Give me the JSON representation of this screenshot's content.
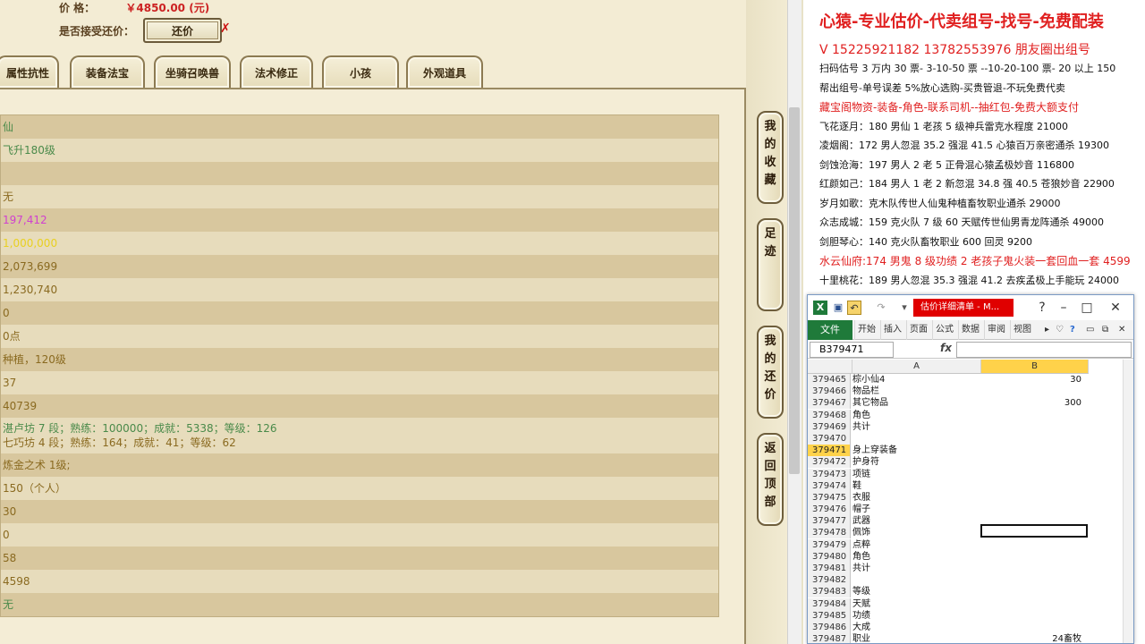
{
  "game": {
    "price_label": "价        格：",
    "price_value": "￥4850.00 (元)",
    "accept_label": "是否接受还价：",
    "counter_button": "还价",
    "close_mark": "✗",
    "tabs": [
      "属性抗性",
      "装备法宝",
      "坐骑召唤兽",
      "法术修正",
      "小孩",
      "外观道具"
    ],
    "rows": [
      {
        "text": "仙",
        "color": "#4a8a4a"
      },
      {
        "text": "飞升180级",
        "color": "#4a8a4a"
      },
      {
        "text": "",
        "color": "#333"
      },
      {
        "text": "无",
        "color": "#8a6a20"
      },
      {
        "text": "197,412",
        "color": "#d040d0"
      },
      {
        "text": "1,000,000",
        "color": "#e8d020"
      },
      {
        "text": "2,073,699",
        "color": "#8a6a20"
      },
      {
        "text": "1,230,740",
        "color": "#8a6a20"
      },
      {
        "text": "0",
        "color": "#8a6a20"
      },
      {
        "text": "0点",
        "color": "#8a6a20"
      },
      {
        "text": "种植，120级",
        "color": "#8a6a20"
      },
      {
        "text": "37",
        "color": "#8a6a20"
      },
      {
        "text": "40739",
        "color": "#8a6a20"
      },
      {
        "text": "湛卢坊 7 段；熟练：100000；成就：5338；等级：126",
        "text2": "七巧坊 4 段；熟练：164；成就：41；等级：62",
        "color": "#4a8a4a",
        "color2": "#8a6a20"
      },
      {
        "text": "炼金之术 1级;",
        "color": "#8a6a20"
      },
      {
        "text": "150（个人）",
        "color": "#8a6a20"
      },
      {
        "text": "30",
        "color": "#8a6a20"
      },
      {
        "text": "0",
        "color": "#8a6a20"
      },
      {
        "text": "58",
        "color": "#8a6a20"
      },
      {
        "text": "4598",
        "color": "#8a6a20"
      },
      {
        "text": "无",
        "color": "#4a8a4a"
      }
    ],
    "side_buttons": [
      "我的收藏",
      "足迹",
      "我的还价",
      "返回顶部"
    ]
  },
  "ad": {
    "title": "心猿-专业估价-代卖组号-找号-免费配装",
    "phones": "V 15225921182   13782553976 朋友圈出组号",
    "lines": [
      {
        "text": "扫码估号 3 万内 30 票- 3-10-50 票  --10-20-100 票- 20 以上 150",
        "red": false
      },
      {
        "text": "帮出组号-单号误差 5%放心选购-买贵管退-不玩免费代卖",
        "red": false
      },
      {
        "text": "藏宝阁物资-装备-角色-联系司机--抽红包-免费大额支付",
        "red": true
      },
      {
        "text": "飞花逐月：180 男仙 1 老孩 5 级神兵雷克水程度 21000",
        "red": false
      },
      {
        "text": "凌烟阁：172 男人忽混 35.2 强混 41.5 心猿百万亲密通杀 19300",
        "red": false
      },
      {
        "text": "剑蚀沧海：197 男人 2 老 5 正骨混心猿孟极妙音 116800",
        "red": false
      },
      {
        "text": "红颜如己：184 男人 1 老 2 新忽混 34.8 强 40.5 苍狼妙音 22900",
        "red": false
      },
      {
        "text": "岁月如歌：克木队传世人仙鬼种植畜牧职业通杀 29000",
        "red": false
      },
      {
        "text": "众志成城：159 克火队 7 级 60 天赋传世仙男青龙阵通杀 49000",
        "red": false
      },
      {
        "text": "剑胆琴心：140 克火队畜牧职业 600 回灵 9200",
        "red": false
      },
      {
        "text": "水云仙府:174 男鬼 8 级功绩 2 老孩子鬼火装一套回血一套 4599",
        "red": true
      },
      {
        "text": "十里桃花：189 男人忽混 35.3 强混 41.2 去疾孟极上手能玩 24000",
        "red": false
      }
    ]
  },
  "excel": {
    "doc_title": "估价详细清单 - M...",
    "ribbon_file": "文件",
    "ribbon_tabs": [
      "开始",
      "插入",
      "页面",
      "公式",
      "数据",
      "审阅",
      "视图"
    ],
    "name_box": "B379471",
    "fx": "fx",
    "col_a": "A",
    "col_b": "B",
    "selected_row": "379471",
    "rows": [
      {
        "n": "379465",
        "a": "棕小仙4",
        "b": "30"
      },
      {
        "n": "379466",
        "a": "物品栏",
        "b": ""
      },
      {
        "n": "379467",
        "a": "其它物品",
        "b": "300"
      },
      {
        "n": "379468",
        "a": "角色",
        "b": ""
      },
      {
        "n": "379469",
        "a": "共计",
        "b": ""
      },
      {
        "n": "379470",
        "a": "",
        "b": ""
      },
      {
        "n": "379471",
        "a": "身上穿装备",
        "b": ""
      },
      {
        "n": "379472",
        "a": "护身符",
        "b": ""
      },
      {
        "n": "379473",
        "a": "项链",
        "b": ""
      },
      {
        "n": "379474",
        "a": "鞋",
        "b": ""
      },
      {
        "n": "379475",
        "a": "衣服",
        "b": ""
      },
      {
        "n": "379476",
        "a": "帽子",
        "b": ""
      },
      {
        "n": "379477",
        "a": "武器",
        "b": ""
      },
      {
        "n": "379478",
        "a": "佩饰",
        "b": ""
      },
      {
        "n": "379479",
        "a": "点粹",
        "b": ""
      },
      {
        "n": "379480",
        "a": "角色",
        "b": ""
      },
      {
        "n": "379481",
        "a": "共计",
        "b": ""
      },
      {
        "n": "379482",
        "a": "",
        "b": ""
      },
      {
        "n": "379483",
        "a": "等级",
        "b": ""
      },
      {
        "n": "379484",
        "a": "天赋",
        "b": ""
      },
      {
        "n": "379485",
        "a": "功绩",
        "b": ""
      },
      {
        "n": "379486",
        "a": "大成",
        "b": ""
      },
      {
        "n": "379487",
        "a": "职业",
        "b": "24畜牧"
      }
    ]
  },
  "colors": {
    "panel_bg": "#f4edd6",
    "row_dark": "#d8c79e",
    "accent_red": "#e02020",
    "excel_green": "#1f7a3a",
    "excel_sel": "#ffd24a"
  }
}
